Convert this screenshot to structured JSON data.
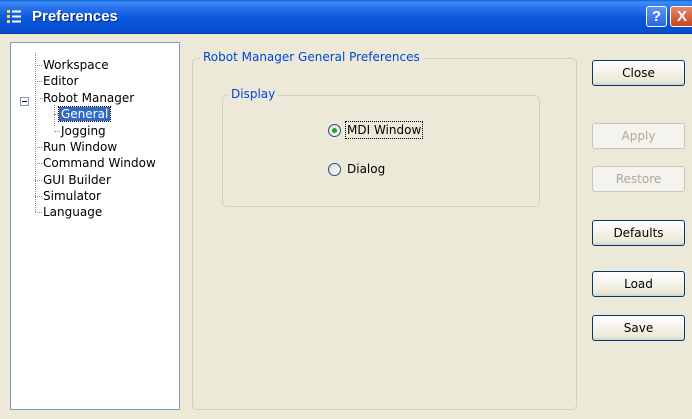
{
  "window": {
    "title": "Preferences",
    "help_label": "?",
    "close_label": "X",
    "icon": "preferences-icon"
  },
  "tree": {
    "items": [
      {
        "label": "Workspace"
      },
      {
        "label": "Editor"
      },
      {
        "label": "Robot Manager",
        "expanded": true
      },
      {
        "label": "General",
        "selected": true
      },
      {
        "label": "Jogging"
      },
      {
        "label": "Run Window"
      },
      {
        "label": "Command Window"
      },
      {
        "label": "GUI Builder"
      },
      {
        "label": "Simulator"
      },
      {
        "label": "Language"
      }
    ]
  },
  "main": {
    "group_title": "Robot Manager General Preferences",
    "display": {
      "title": "Display",
      "options": [
        {
          "label": "MDI Window",
          "checked": true
        },
        {
          "label": "Dialog",
          "checked": false
        }
      ]
    }
  },
  "buttons": {
    "close": "Close",
    "apply": "Apply",
    "restore": "Restore",
    "defaults": "Defaults",
    "load": "Load",
    "save": "Save"
  },
  "colors": {
    "titlebar": "#0a58dc",
    "group_title": "#0046d5",
    "selection": "#316ac5",
    "face": "#ece9d8"
  }
}
